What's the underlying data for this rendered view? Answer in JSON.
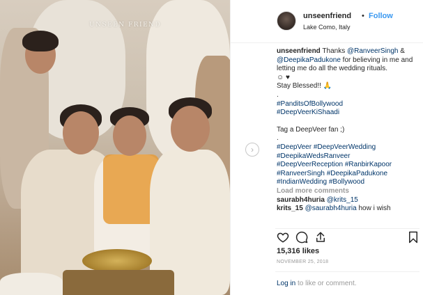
{
  "post": {
    "photo": {
      "watermark": "UNSEEN FRIEND"
    },
    "header": {
      "username": "unseenfriend",
      "separator": "•",
      "follow_label": "Follow",
      "location": "Lake Como, Italy"
    },
    "caption": {
      "username": "unseenfriend",
      "line1_text": " Thanks ",
      "mention1": "@RanveerSingh",
      "line1_amp": " &",
      "mention2": "@DeepikaPadukone",
      "line2_rest": " for believing in me and letting me do all the wedding rituals.",
      "emoji_line": "☺ ♥",
      "blessed": "Stay Blessed!! 🙏",
      "dot1": ".",
      "hashtag1": "#PanditsOfBollywood",
      "hashtag2": "#DeepVeerKiShaadi",
      "tag_prompt": "Tag a DeepVeer fan ;)",
      "dot2": ".",
      "hashtags_block": [
        "#DeepVeer #DeepVeerWedding",
        "#DeepikaWedsRanveer",
        "#DeepVeerReception #RanbirKapoor",
        "#RanveerSingh #DeepikaPadukone",
        "#IndianWedding #Bollywood"
      ]
    },
    "load_more": "Load more comments",
    "comments": [
      {
        "username": "saurabh4huria",
        "mention": "@krits_15",
        "text": ""
      },
      {
        "username": "krits_15",
        "mention": "@saurabh4huria",
        "text": " how i wish"
      }
    ],
    "likes": "15,316 likes",
    "date": "NOVEMBER 25, 2018",
    "login": {
      "link": "Log in",
      "rest": " to like or comment."
    },
    "icons": {
      "like": "heart-icon",
      "comment": "comment-icon",
      "share": "share-icon",
      "save": "bookmark-icon",
      "next": "chevron-right-icon"
    },
    "colors": {
      "link_blue": "#3897f0",
      "tag_blue": "#003569",
      "muted_gray": "#999999"
    }
  }
}
